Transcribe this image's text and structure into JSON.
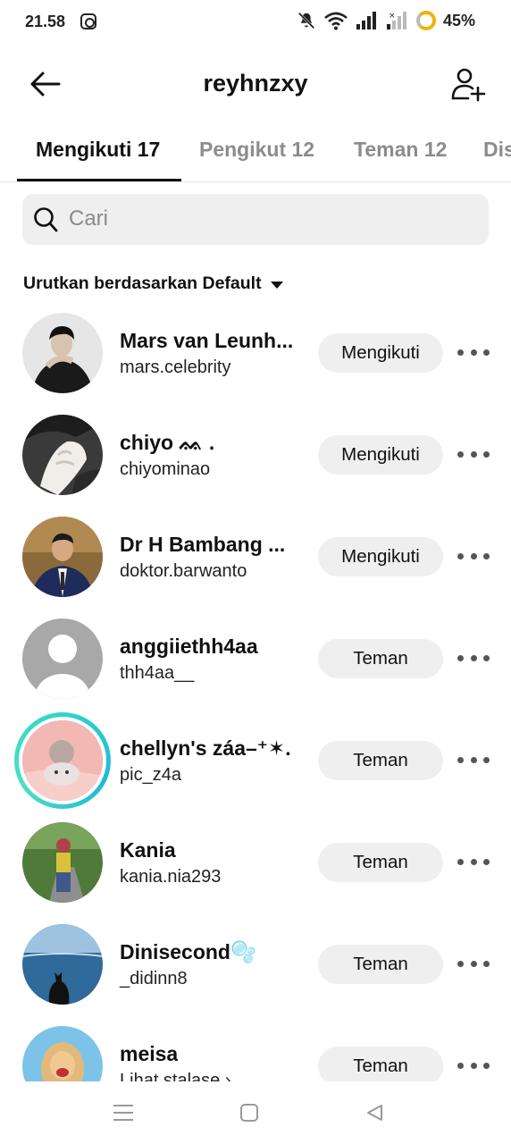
{
  "status_bar": {
    "time": "21.58",
    "battery": "45%",
    "icons": [
      "instagram-icon",
      "mute-icon",
      "wifi-icon",
      "signal-icon",
      "signal-no-data-icon",
      "battery-icon"
    ]
  },
  "header": {
    "title": "reyhnzxy",
    "back_icon": "arrow-left-icon",
    "add_icon": "person-add-icon"
  },
  "tabs": [
    {
      "label": "Mengikuti 17",
      "active": true
    },
    {
      "label": "Pengikut 12",
      "active": false
    },
    {
      "label": "Teman 12",
      "active": false
    },
    {
      "label": "Dis",
      "active": false
    }
  ],
  "search": {
    "placeholder": "Cari",
    "value": ""
  },
  "sort": {
    "label": "Urutkan berdasarkan Default"
  },
  "users": [
    {
      "name": "Mars van Leunh...",
      "username": "mars.celebrity",
      "button": "Mengikuti"
    },
    {
      "name": "chiyo ᨐ .",
      "username": "chiyominao",
      "button": "Mengikuti"
    },
    {
      "name": "Dr H Bambang ...",
      "username": "doktor.barwanto",
      "button": "Mengikuti"
    },
    {
      "name": "anggiiethh4aa",
      "username": "thh4aa__",
      "button": "Teman"
    },
    {
      "name": "chellyn's záa–⁺✶.",
      "username": "pic_z4a",
      "button": "Teman"
    },
    {
      "name": "Kania",
      "username": "kania.nia293",
      "button": "Teman"
    },
    {
      "name": "Dinisecond🫧",
      "username": "_didinn8",
      "button": "Teman"
    },
    {
      "name": "meisa",
      "username": "Lihat stalase ›",
      "button": "Teman"
    }
  ],
  "colors": {
    "button_bg": "#efefef",
    "story_ring": "#2fd6c9",
    "battery": "#f0b400"
  }
}
